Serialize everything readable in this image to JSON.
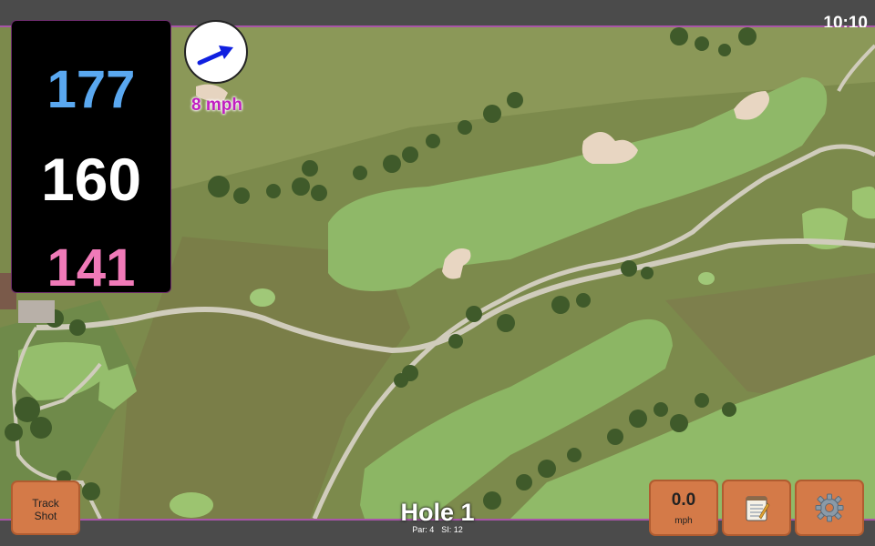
{
  "status": {
    "time": "10:10"
  },
  "distances": {
    "back": "177",
    "middle": "160",
    "front": "141"
  },
  "wind": {
    "speed": "8 mph",
    "direction_icon": "arrow-icon"
  },
  "hole": {
    "title": "Hole 1",
    "par": "Par: 4",
    "stroke_index": "SI: 12"
  },
  "buttons": {
    "track_shot": [
      "Track",
      "Shot"
    ],
    "speed_value": "0.0",
    "speed_unit": "mph",
    "notes_icon": "notepad-icon",
    "settings_icon": "gear-icon"
  },
  "colors": {
    "back": "#5aa8f0",
    "middle": "#ffffff",
    "front": "#f07ab8",
    "wind_text": "#c01ec0",
    "button": "#d47a48",
    "bar_accent": "#a855a8"
  }
}
